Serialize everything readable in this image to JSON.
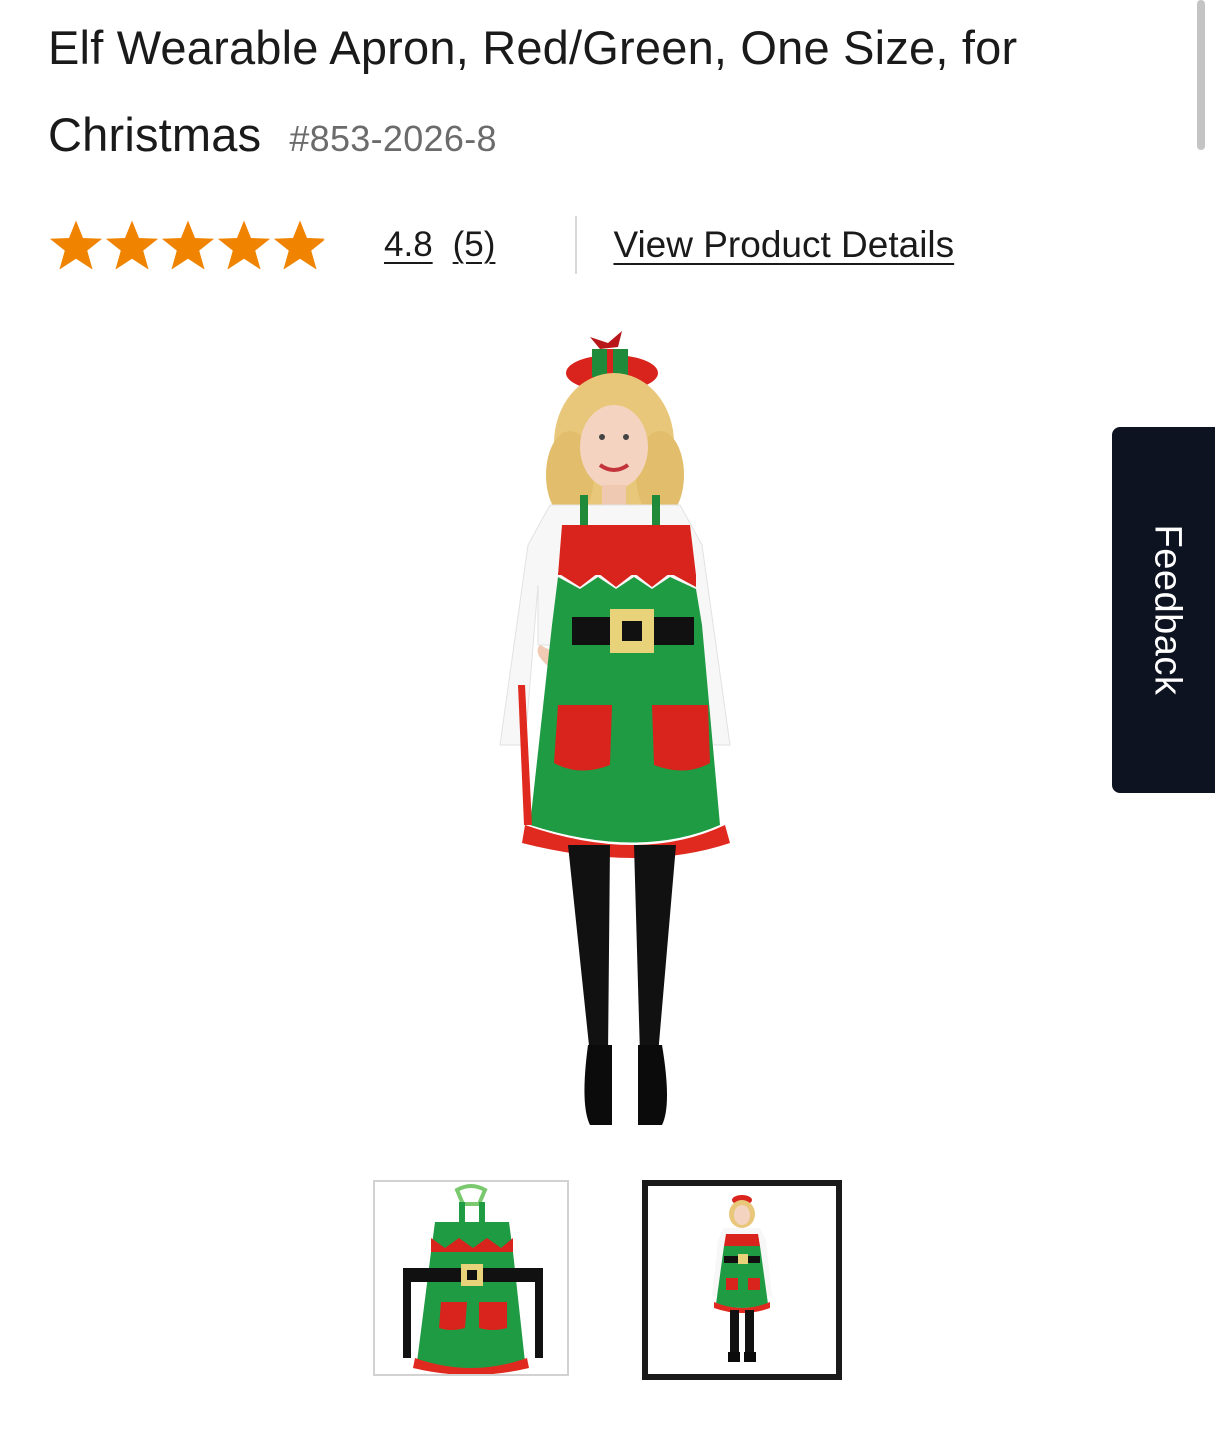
{
  "product": {
    "title_line1": "Elf Wearable Apron, Red/Green, One Size, for",
    "title_line2": "Christmas",
    "sku": "#853-2026-8"
  },
  "rating": {
    "stars": 4.8,
    "max_stars": 5,
    "value": "4.8",
    "count": "(5)",
    "star_color": "#f08300"
  },
  "links": {
    "view_details": "View Product Details"
  },
  "images": {
    "main": "model-wearing-elf-apron",
    "thumbnails": [
      "apron-flat-view",
      "model-wearing-elf-apron"
    ],
    "selected_thumbnail": 2
  },
  "feedback": {
    "label": "Feedback"
  }
}
